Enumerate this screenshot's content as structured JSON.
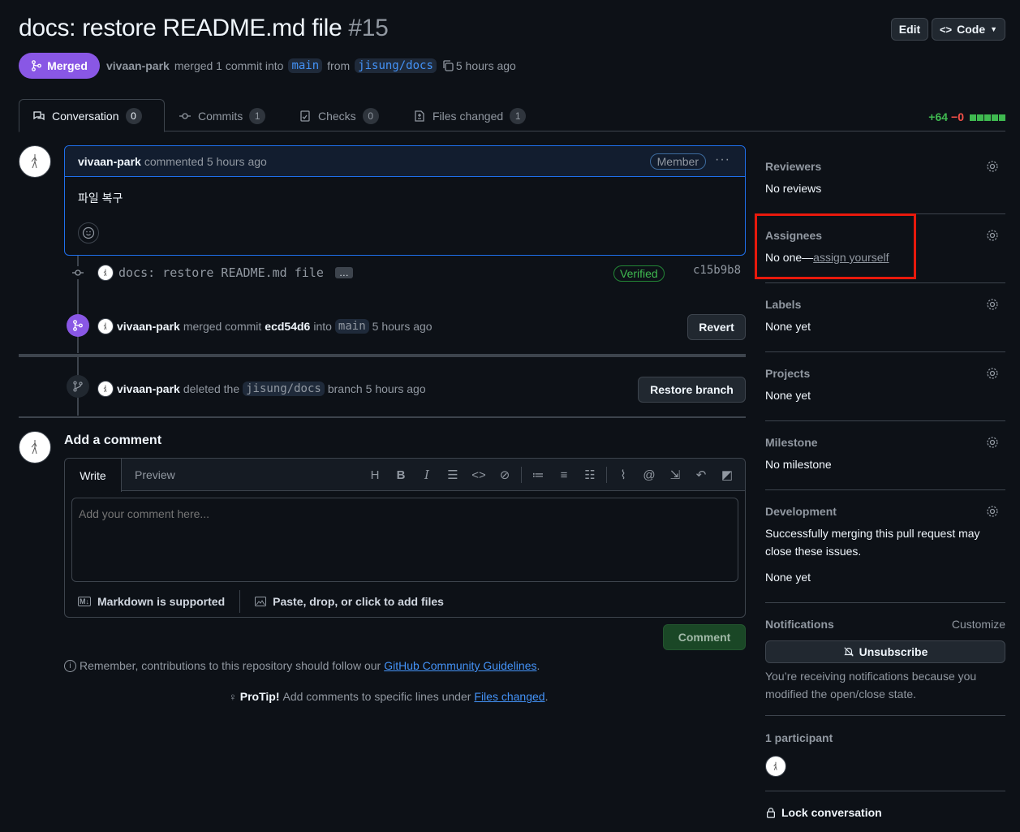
{
  "header": {
    "title": "docs: restore README.md file",
    "number": "#15",
    "edit_label": "Edit",
    "code_label": "Code",
    "status": "Merged",
    "author": "vivaan-park",
    "merge_text": "merged 1 commit into",
    "base_branch": "main",
    "from_text": "from",
    "head_branch": "jisung/docs",
    "time": "5 hours ago"
  },
  "tabs": [
    {
      "label": "Conversation",
      "count": "0"
    },
    {
      "label": "Commits",
      "count": "1"
    },
    {
      "label": "Checks",
      "count": "0"
    },
    {
      "label": "Files changed",
      "count": "1"
    }
  ],
  "diffstat": {
    "additions": "+64",
    "deletions": "−0"
  },
  "comment": {
    "author": "vivaan-park",
    "action": "commented 5 hours ago",
    "role": "Member",
    "body": "파일 복구"
  },
  "commit": {
    "message": "docs: restore README.md file",
    "ellipsis": "…",
    "verified": "Verified",
    "sha": "c15b9b8"
  },
  "merge_event": {
    "author": "vivaan-park",
    "text": "merged commit",
    "sha": "ecd54d6",
    "into": "into",
    "branch": "main",
    "time": "5 hours ago",
    "button": "Revert"
  },
  "delete_event": {
    "author": "vivaan-park",
    "text": "deleted the",
    "branch": "jisung/docs",
    "suffix": "branch",
    "time": "5 hours ago",
    "button": "Restore branch"
  },
  "add_comment": {
    "title": "Add a comment",
    "write_tab": "Write",
    "preview_tab": "Preview",
    "placeholder": "Add your comment here...",
    "markdown_note": "Markdown is supported",
    "attach_note": "Paste, drop, or click to add files",
    "submit": "Comment"
  },
  "notes": {
    "remember_prefix": "Remember, contributions to this repository should follow our",
    "remember_link": "GitHub Community Guidelines",
    "period": ".",
    "protip_label": "ProTip!",
    "protip_text": "Add comments to specific lines under",
    "protip_link": "Files changed"
  },
  "sidebar": {
    "reviewers": {
      "title": "Reviewers",
      "value": "No reviews"
    },
    "assignees": {
      "title": "Assignees",
      "value": "No one—",
      "link": "assign yourself"
    },
    "labels": {
      "title": "Labels",
      "value": "None yet"
    },
    "projects": {
      "title": "Projects",
      "value": "None yet"
    },
    "milestone": {
      "title": "Milestone",
      "value": "No milestone"
    },
    "development": {
      "title": "Development",
      "desc": "Successfully merging this pull request may close these issues.",
      "value": "None yet"
    },
    "notifications": {
      "title": "Notifications",
      "customize": "Customize",
      "button": "Unsubscribe",
      "desc": "You’re receiving notifications because you modified the open/close state."
    },
    "participants": {
      "title": "1 participant"
    },
    "lock": "Lock conversation"
  },
  "colors": {
    "accent": "#4493f8",
    "merged": "#8957e5",
    "highlight": "#e8190c"
  }
}
